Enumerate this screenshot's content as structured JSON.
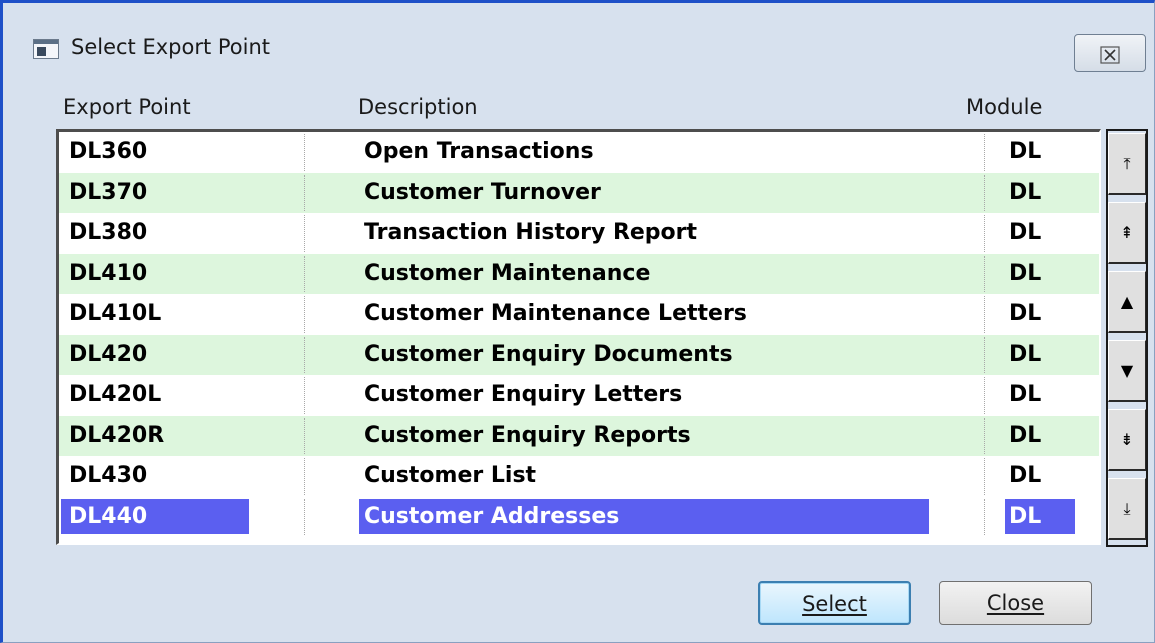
{
  "window": {
    "title": "Select Export Point",
    "close_glyph": "☒"
  },
  "columns": {
    "export_point": "Export Point",
    "description": "Description",
    "module": "Module"
  },
  "rows": [
    {
      "code": "DL360",
      "description": "Open Transactions",
      "module": "DL"
    },
    {
      "code": "DL370",
      "description": "Customer Turnover",
      "module": "DL"
    },
    {
      "code": "DL380",
      "description": "Transaction History Report",
      "module": "DL"
    },
    {
      "code": "DL410",
      "description": "Customer Maintenance",
      "module": "DL"
    },
    {
      "code": "DL410L",
      "description": "Customer Maintenance Letters",
      "module": "DL"
    },
    {
      "code": "DL420",
      "description": "Customer Enquiry Documents",
      "module": "DL"
    },
    {
      "code": "DL420L",
      "description": "Customer Enquiry Letters",
      "module": "DL"
    },
    {
      "code": "DL420R",
      "description": "Customer Enquiry Reports",
      "module": "DL"
    },
    {
      "code": "DL430",
      "description": "Customer List",
      "module": "DL"
    },
    {
      "code": "DL440",
      "description": "Customer Addresses",
      "module": "DL"
    }
  ],
  "selected_row": 9,
  "scroll_buttons": {
    "first": "⤒",
    "page_up": "⇞",
    "up": "▲",
    "down": "▼",
    "page_down": "⇟",
    "last": "⤓"
  },
  "buttons": {
    "select": "Select",
    "close": "Close"
  },
  "colors": {
    "row_alt": "#ddf6dd",
    "selection": "#5b5ff0",
    "window_bg": "#d7e1ee"
  }
}
